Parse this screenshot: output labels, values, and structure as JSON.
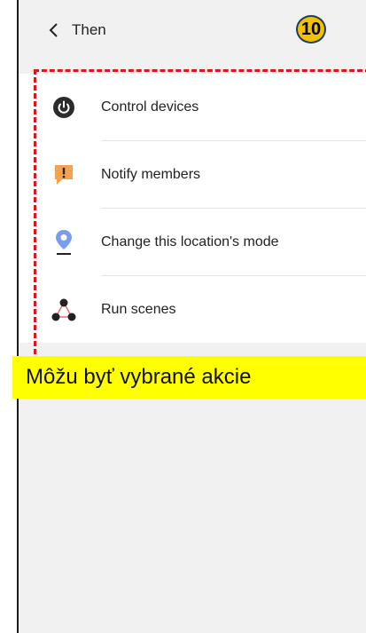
{
  "header": {
    "title": "Then"
  },
  "step_badge": "10",
  "actions": [
    {
      "label": "Control devices",
      "icon": "power-icon"
    },
    {
      "label": "Notify members",
      "icon": "notification-icon"
    },
    {
      "label": "Change this location's mode",
      "icon": "location-pin-icon"
    },
    {
      "label": "Run scenes",
      "icon": "scenes-icon"
    }
  ],
  "caption": "Môžu byť vybrané akcie",
  "colors": {
    "background": "#f1f1f1",
    "card": "#ffffff",
    "highlight_border": "#e0161b",
    "caption_bg": "#ffff00",
    "badge": "#f2c200",
    "notify_icon": "#f5a250",
    "location_icon": "#7a9cf0"
  }
}
